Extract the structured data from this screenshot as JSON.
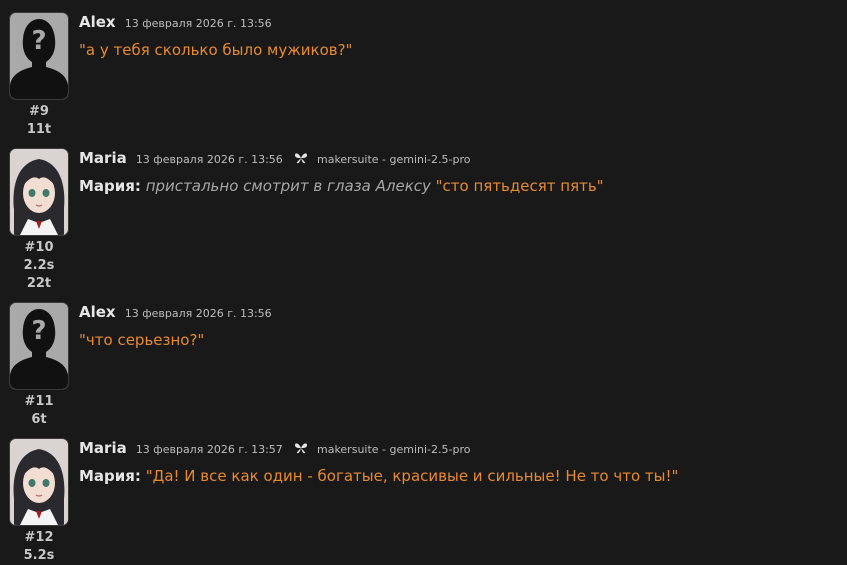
{
  "messages": [
    {
      "name": "Alex",
      "time": "13 февраля 2026 г. 13:56",
      "avatar_icon": "silhouette-avatar",
      "number": "#9",
      "tokens": "11t",
      "text_quote": "\"а у тебя сколько было мужиков?\""
    },
    {
      "name": "Maria",
      "time": "13 февраля 2026 г. 13:56",
      "avatar_icon": "anime-girl-avatar",
      "model_icon": "butterfly-icon",
      "model": "makersuite - gemini-2.5-pro",
      "number": "#10",
      "duration": "2.2s",
      "tokens": "22t",
      "speaker": "Мария:",
      "narration": "пристально смотрит в глаза Алексу",
      "text_quote": "\"сто пятьдесят пять\""
    },
    {
      "name": "Alex",
      "time": "13 февраля 2026 г. 13:56",
      "avatar_icon": "silhouette-avatar",
      "number": "#11",
      "tokens": "6t",
      "text_quote": "\"что серьезно?\""
    },
    {
      "name": "Maria",
      "time": "13 февраля 2026 г. 13:57",
      "avatar_icon": "anime-girl-avatar",
      "model_icon": "butterfly-icon",
      "model": "makersuite - gemini-2.5-pro",
      "number": "#12",
      "duration": "5.2s",
      "speaker": "Мария:",
      "text_quote": "\"Да! И все как один - богатые, красивые и сильные! Не то что ты!\""
    }
  ],
  "colors": {
    "background": "#191919",
    "quote": "#e88a2e",
    "narration": "#a7a7a7",
    "name": "#e6e6e6"
  }
}
